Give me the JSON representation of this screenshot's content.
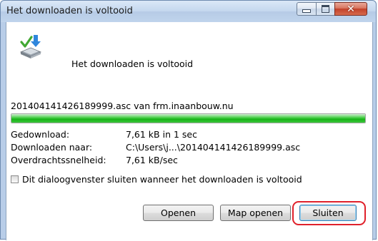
{
  "window": {
    "title": "Het downloaden is voltooid",
    "controls": {
      "minimize_icon": "minimize-icon",
      "maximize_icon": "maximize-icon",
      "close_icon": "close-icon",
      "close_glyph": "✕"
    }
  },
  "content": {
    "icon": "download-complete-icon",
    "headline": "Het downloaden is voltooid",
    "file_line": "201404141426189999.asc van frm.inaanbouw.nu",
    "progress": 1.0,
    "details": [
      {
        "label": "Gedownload:",
        "value": "7,61 kB in 1 sec"
      },
      {
        "label": "Downloaden naar:",
        "value": "C:\\Users\\j...\\201404141426189999.asc"
      },
      {
        "label": "Overdrachtssnelheid:",
        "value": "7,61 kB/sec"
      }
    ],
    "checkbox": {
      "label": "Dit dialoogvenster sluiten wanneer het downloaden is voltooid",
      "checked": false
    }
  },
  "buttons": {
    "open": "Openen",
    "open_folder": "Map openen",
    "close": "Sluiten"
  },
  "colors": {
    "progress_green": "#17b417",
    "highlight_red": "#e0212b",
    "titlebar": "#c4d7ee"
  }
}
